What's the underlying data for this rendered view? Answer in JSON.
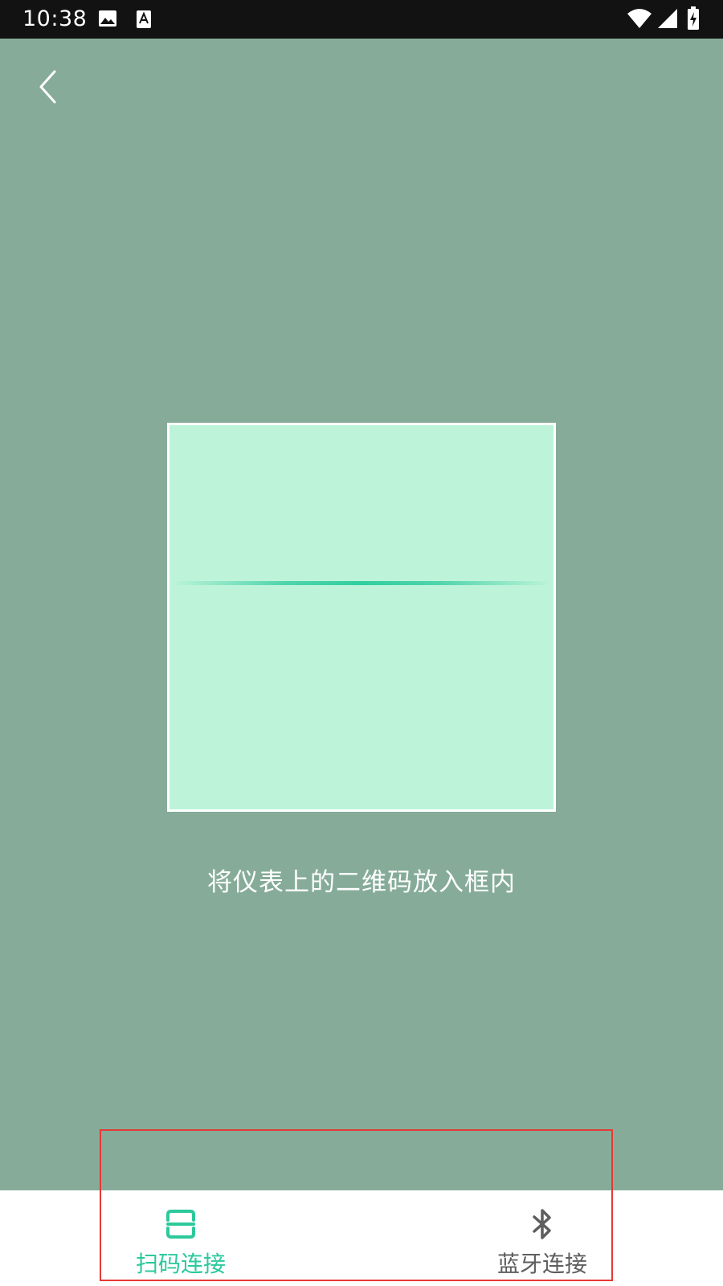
{
  "status_bar": {
    "time": "10:38",
    "icons": [
      "image-icon",
      "a-icon",
      "wifi-icon",
      "signal-icon",
      "battery-charging-icon"
    ]
  },
  "navigation": {
    "back_icon": "chevron-left-icon"
  },
  "scanner": {
    "hint": "将仪表上的二维码放入框内",
    "frame_fill": "#bdf4d9",
    "line_color": "#2fcf9f"
  },
  "tabs": [
    {
      "label": "扫码连接",
      "icon": "scan-icon",
      "active": true,
      "color": "#2cc99c"
    },
    {
      "label": "蓝牙连接",
      "icon": "bluetooth-icon",
      "active": false,
      "color": "#5e5e5e"
    }
  ],
  "colors": {
    "background": "#86ac99",
    "status_bar": "#121212",
    "highlight": "#e53935"
  }
}
